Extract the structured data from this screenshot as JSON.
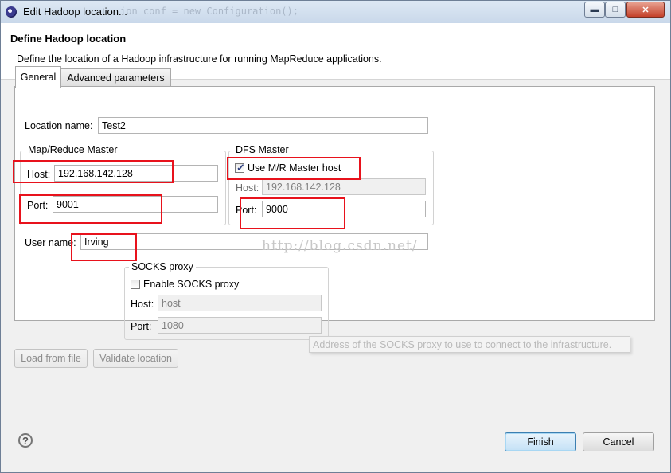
{
  "window": {
    "title": "Edit Hadoop location...",
    "background_code": "ion conf = new Configuration();"
  },
  "header": {
    "title": "Define Hadoop location",
    "description": "Define the location of a Hadoop infrastructure for running MapReduce applications."
  },
  "tabs": [
    {
      "label": "General",
      "active": true
    },
    {
      "label": "Advanced parameters",
      "active": false
    }
  ],
  "general": {
    "location_name_label": "Location name:",
    "location_name_value": "Test2",
    "mapreduce_master": {
      "legend": "Map/Reduce Master",
      "host_label": "Host:",
      "host_value": "192.168.142.128",
      "port_label": "Port:",
      "port_value": "9001"
    },
    "dfs_master": {
      "legend": "DFS Master",
      "use_mr_host_label": "Use M/R Master host",
      "use_mr_host_checked": true,
      "host_label": "Host:",
      "host_value": "192.168.142.128",
      "port_label": "Port:",
      "port_value": "9000"
    },
    "user_name_label": "User name:",
    "user_name_value": "Irving",
    "socks_proxy": {
      "legend": "SOCKS proxy",
      "enable_label": "Enable SOCKS proxy",
      "enable_checked": false,
      "host_label": "Host:",
      "host_value": "host",
      "port_label": "Port:",
      "port_value": "1080"
    }
  },
  "watermark": "http://blog.csdn.net/",
  "tooltip": "Address of the SOCKS proxy to use to connect to the infrastructure.",
  "buttons": {
    "load_from_file": "Load from file",
    "validate_location": "Validate location",
    "finish": "Finish",
    "cancel": "Cancel",
    "help": "?"
  },
  "colors": {
    "highlight_red": "#e8121c",
    "default_button_blue": "#3c7fb1"
  }
}
